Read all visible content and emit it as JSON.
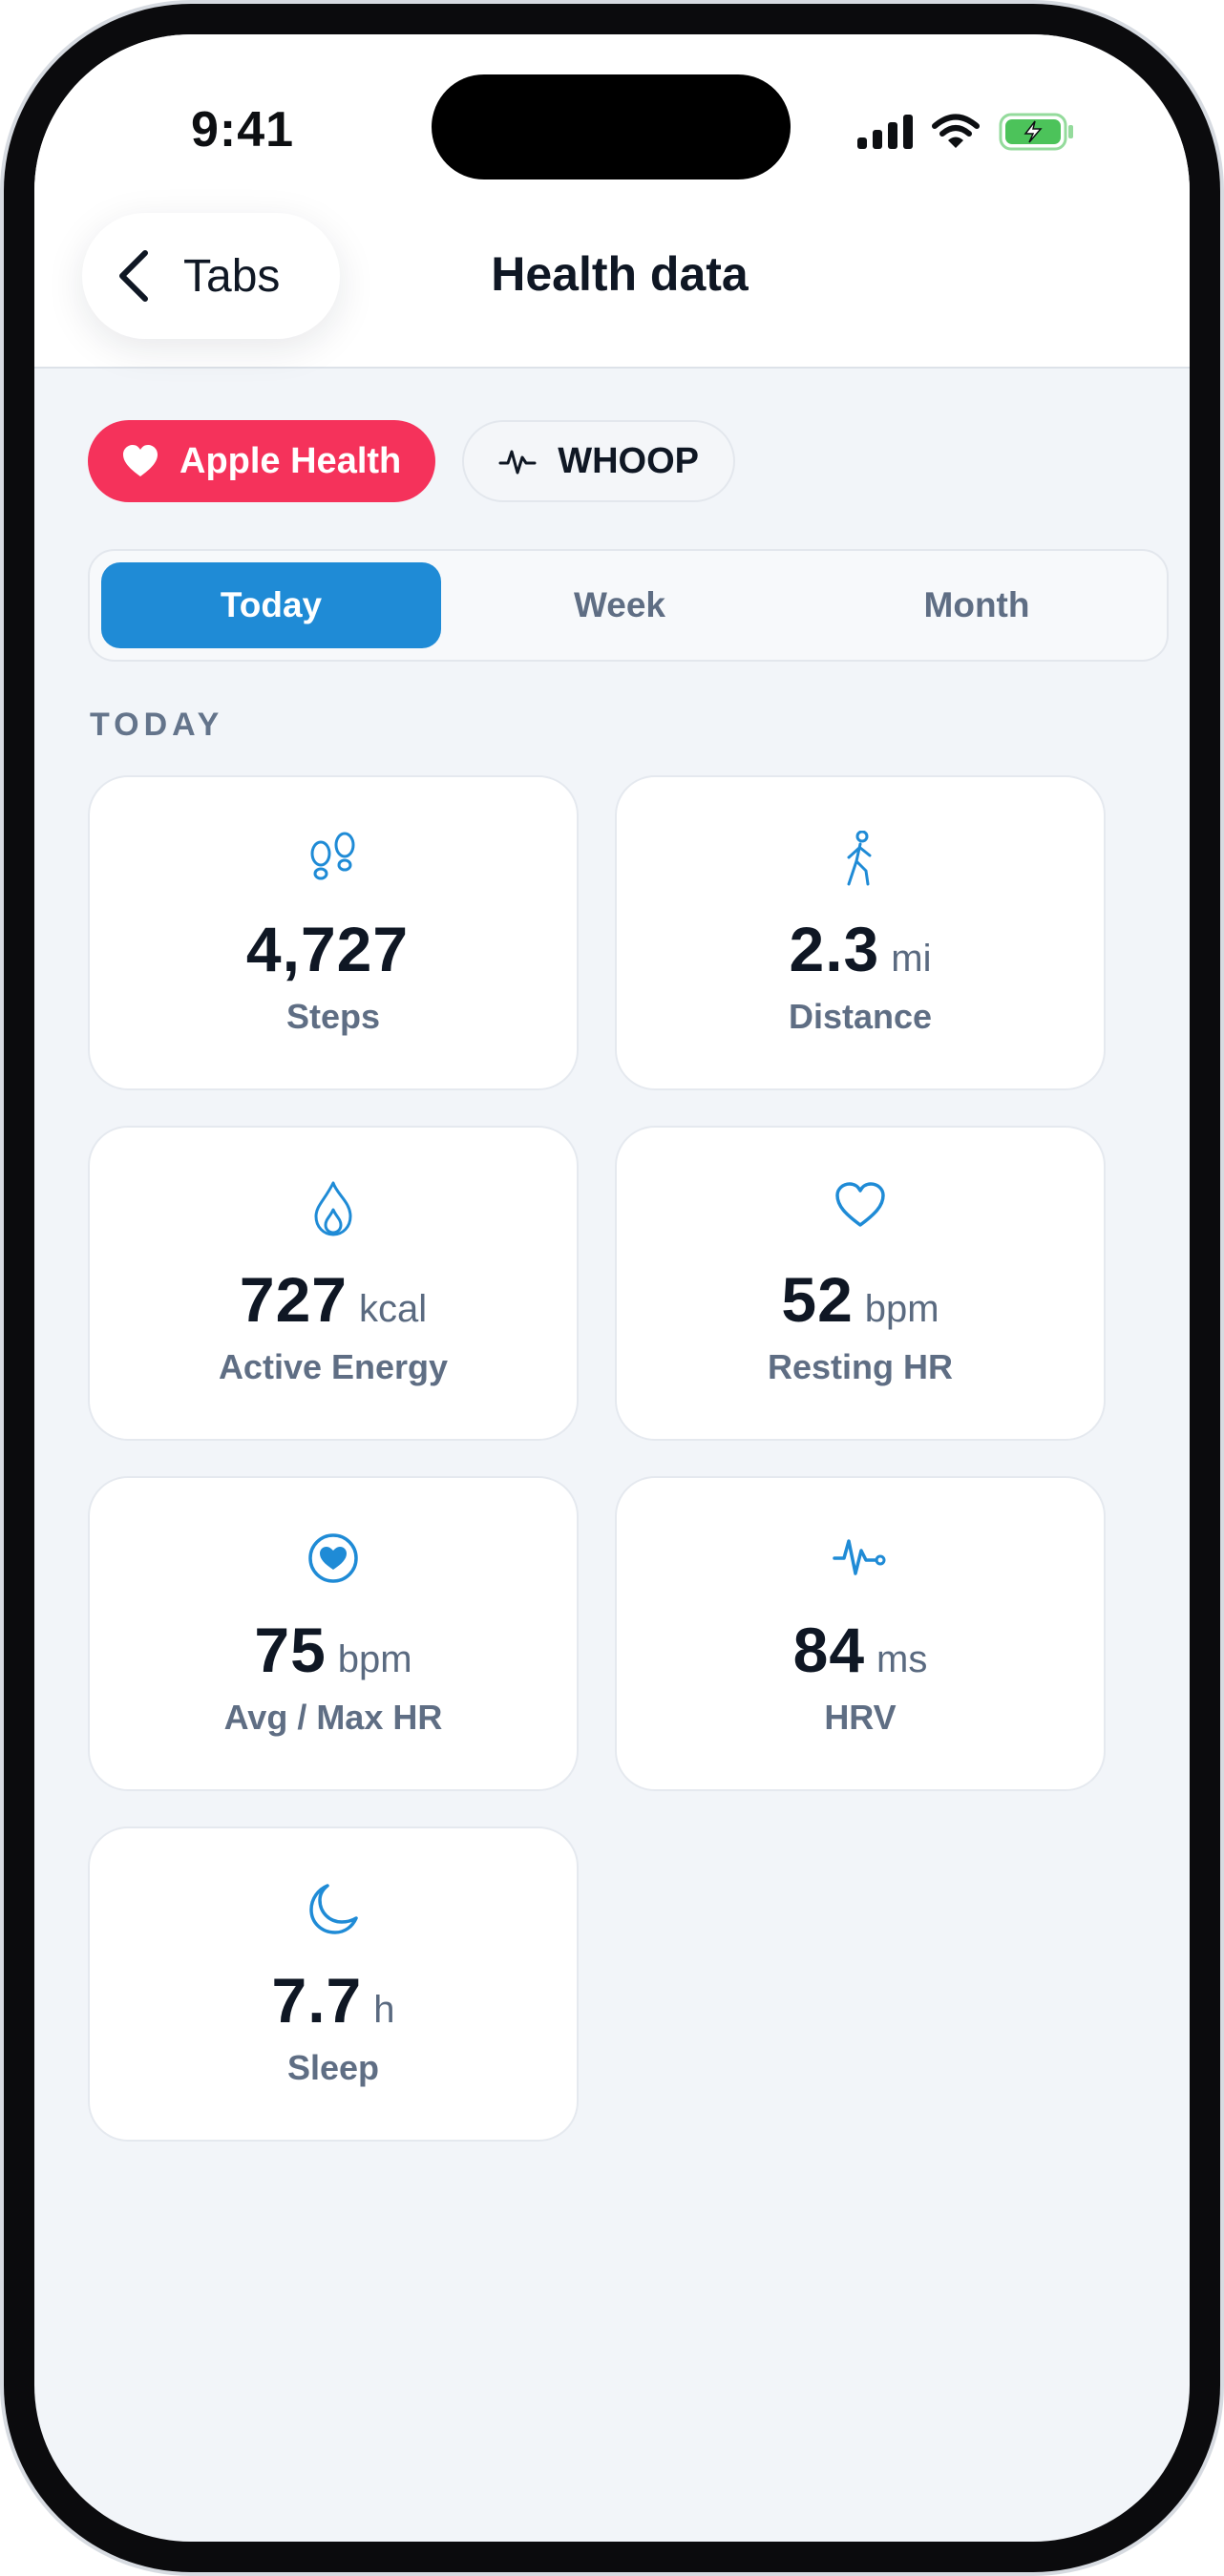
{
  "status_bar": {
    "time": "9:41"
  },
  "nav": {
    "back_label": "Tabs",
    "title": "Health data"
  },
  "sources": [
    {
      "label": "Apple Health",
      "icon": "heart-icon",
      "active": true,
      "color": "#f5325b"
    },
    {
      "label": "WHOOP",
      "icon": "pulse-icon",
      "active": false
    }
  ],
  "periods": [
    {
      "label": "Today",
      "active": true
    },
    {
      "label": "Week",
      "active": false
    },
    {
      "label": "Month",
      "active": false
    }
  ],
  "section_label": "TODAY",
  "accent_color": "#1f8bd6",
  "metrics": [
    {
      "icon": "footprints-icon",
      "value": "4,727",
      "unit": "",
      "label": "Steps"
    },
    {
      "icon": "walking-person-icon",
      "value": "2.3",
      "unit": "mi",
      "label": "Distance"
    },
    {
      "icon": "flame-icon",
      "value": "727",
      "unit": "kcal",
      "label": "Active Energy"
    },
    {
      "icon": "heart-outline-icon",
      "value": "52",
      "unit": "bpm",
      "label": "Resting HR"
    },
    {
      "icon": "heart-circle-icon",
      "value": "75",
      "unit": "bpm",
      "label": "Avg / Max HR"
    },
    {
      "icon": "heartbeat-wave-icon",
      "value": "84",
      "unit": "ms",
      "label": "HRV"
    },
    {
      "icon": "moon-icon",
      "value": "7.7",
      "unit": "h",
      "label": "Sleep"
    }
  ]
}
